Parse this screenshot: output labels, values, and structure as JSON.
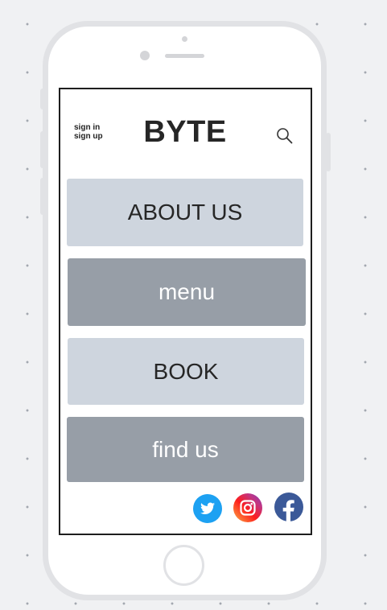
{
  "header": {
    "sign_in": "sign in",
    "sign_up": "sign up",
    "brand": "BYTE",
    "search_icon": "search-icon"
  },
  "nav": {
    "about": "ABOUT US",
    "menu": "menu",
    "book": "BOOK",
    "find": "find us"
  },
  "social": {
    "icons": [
      "twitter-icon",
      "instagram-icon",
      "facebook-icon"
    ]
  },
  "colors": {
    "button_light": "#ced5de",
    "button_dark": "#979ea7",
    "twitter": "#1da1f2",
    "facebook": "#3b5998"
  }
}
